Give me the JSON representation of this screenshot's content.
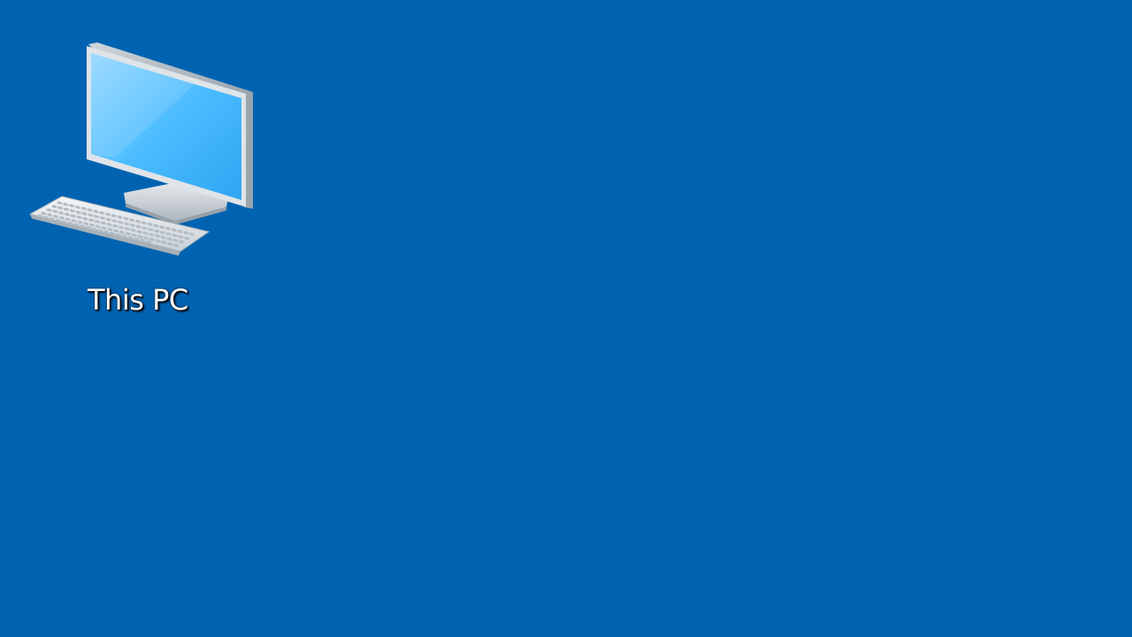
{
  "desktop": {
    "background_color": "#0063b1",
    "icons": [
      {
        "label": "This PC",
        "icon": "computer-icon"
      }
    ]
  }
}
